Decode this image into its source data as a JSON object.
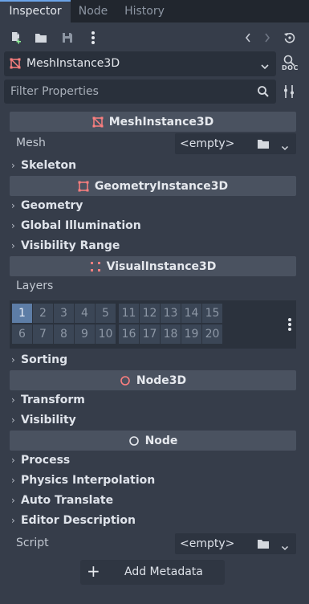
{
  "tabs": [
    {
      "label": "Inspector",
      "active": true
    },
    {
      "label": "Node",
      "active": false
    },
    {
      "label": "History",
      "active": false
    }
  ],
  "toolbar": {
    "icons": [
      "new-resource-icon",
      "load-resource-icon",
      "save-icon",
      "more-icon",
      "back-icon",
      "forward-icon",
      "history-icon"
    ]
  },
  "object": {
    "name": "MeshInstance3D",
    "doc_label": "DOC"
  },
  "filter": {
    "placeholder": "Filter Properties"
  },
  "categories": {
    "mesh_instance": "MeshInstance3D",
    "geometry_instance": "GeometryInstance3D",
    "visual_instance": "VisualInstance3D",
    "node3d": "Node3D",
    "node": "Node"
  },
  "properties": {
    "mesh": {
      "label": "Mesh",
      "value": "<empty>"
    },
    "layers": {
      "label": "Layers"
    },
    "script": {
      "label": "Script",
      "value": "<empty>"
    }
  },
  "sections": {
    "skeleton": "Skeleton",
    "geometry": "Geometry",
    "global_illumination": "Global Illumination",
    "visibility_range": "Visibility Range",
    "sorting": "Sorting",
    "transform": "Transform",
    "visibility": "Visibility",
    "process": "Process",
    "physics_interpolation": "Physics Interpolation",
    "auto_translate": "Auto Translate",
    "editor_description": "Editor Description"
  },
  "layers": {
    "row1": [
      "1",
      "2",
      "3",
      "4",
      "5",
      "11",
      "12",
      "13",
      "14",
      "15"
    ],
    "row2": [
      "6",
      "7",
      "8",
      "9",
      "10",
      "16",
      "17",
      "18",
      "19",
      "20"
    ],
    "enabled": [
      "1"
    ]
  },
  "add_metadata": {
    "label": "Add Metadata"
  },
  "colors": {
    "accent": "#6ba3e8",
    "mesh_icon": "#fc7f7f",
    "layer_on": "#5d7da6"
  }
}
